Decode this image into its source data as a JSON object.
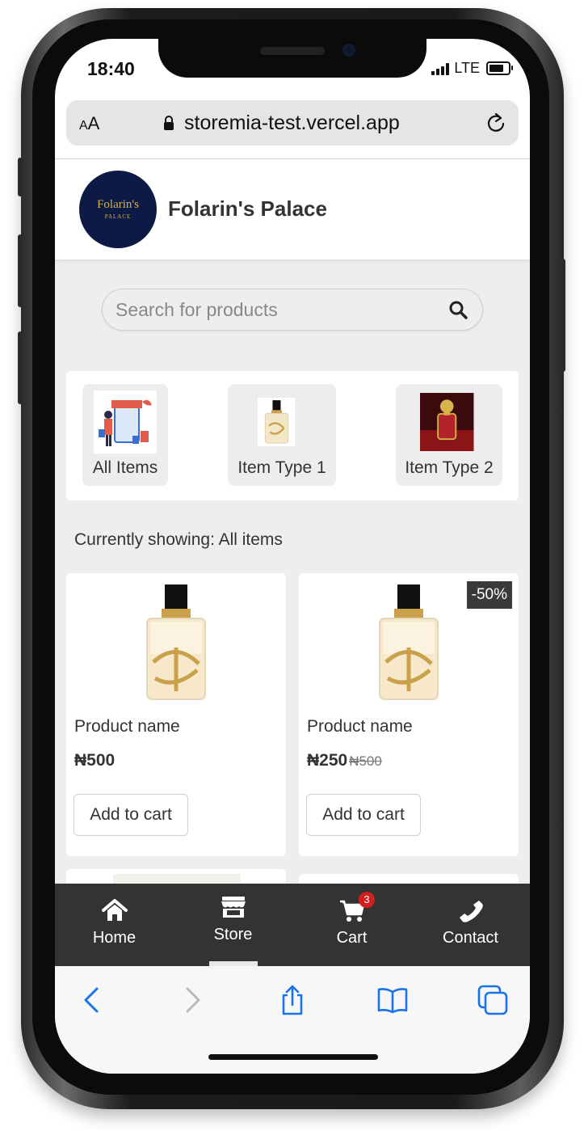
{
  "status_bar": {
    "time": "18:40",
    "network": "LTE"
  },
  "browser": {
    "text_size_label": "AA",
    "url": "storemia-test.vercel.app"
  },
  "store": {
    "logo_text": "Folarin's",
    "logo_subtext": "PALACE",
    "name": "Folarin's Palace"
  },
  "search": {
    "placeholder": "Search for products"
  },
  "categories": [
    {
      "label": "All Items"
    },
    {
      "label": "Item Type 1"
    },
    {
      "label": "Item Type 2"
    }
  ],
  "filter_status": "Currently showing: All items",
  "products": [
    {
      "name": "Product name",
      "price": "₦500",
      "old_price": "",
      "discount": "",
      "button": "Add to cart"
    },
    {
      "name": "Product name",
      "price": "₦250",
      "old_price": "₦500",
      "discount": "-50%",
      "button": "Add to cart"
    }
  ],
  "bottom_nav": {
    "items": [
      {
        "label": "Home",
        "icon": "home-icon"
      },
      {
        "label": "Store",
        "icon": "store-icon",
        "active": true
      },
      {
        "label": "Cart",
        "icon": "cart-icon",
        "badge": "3"
      },
      {
        "label": "Contact",
        "icon": "phone-icon"
      }
    ]
  },
  "safari_toolbar": {
    "icons": [
      "back-icon",
      "forward-icon",
      "share-icon",
      "bookmarks-icon",
      "tabs-icon"
    ]
  },
  "colors": {
    "accent_blue": "#1a73e8",
    "nav_background": "#333333",
    "badge_red": "#d21f1f",
    "logo_navy": "#0c1a45",
    "logo_gold": "#d8b24a"
  }
}
